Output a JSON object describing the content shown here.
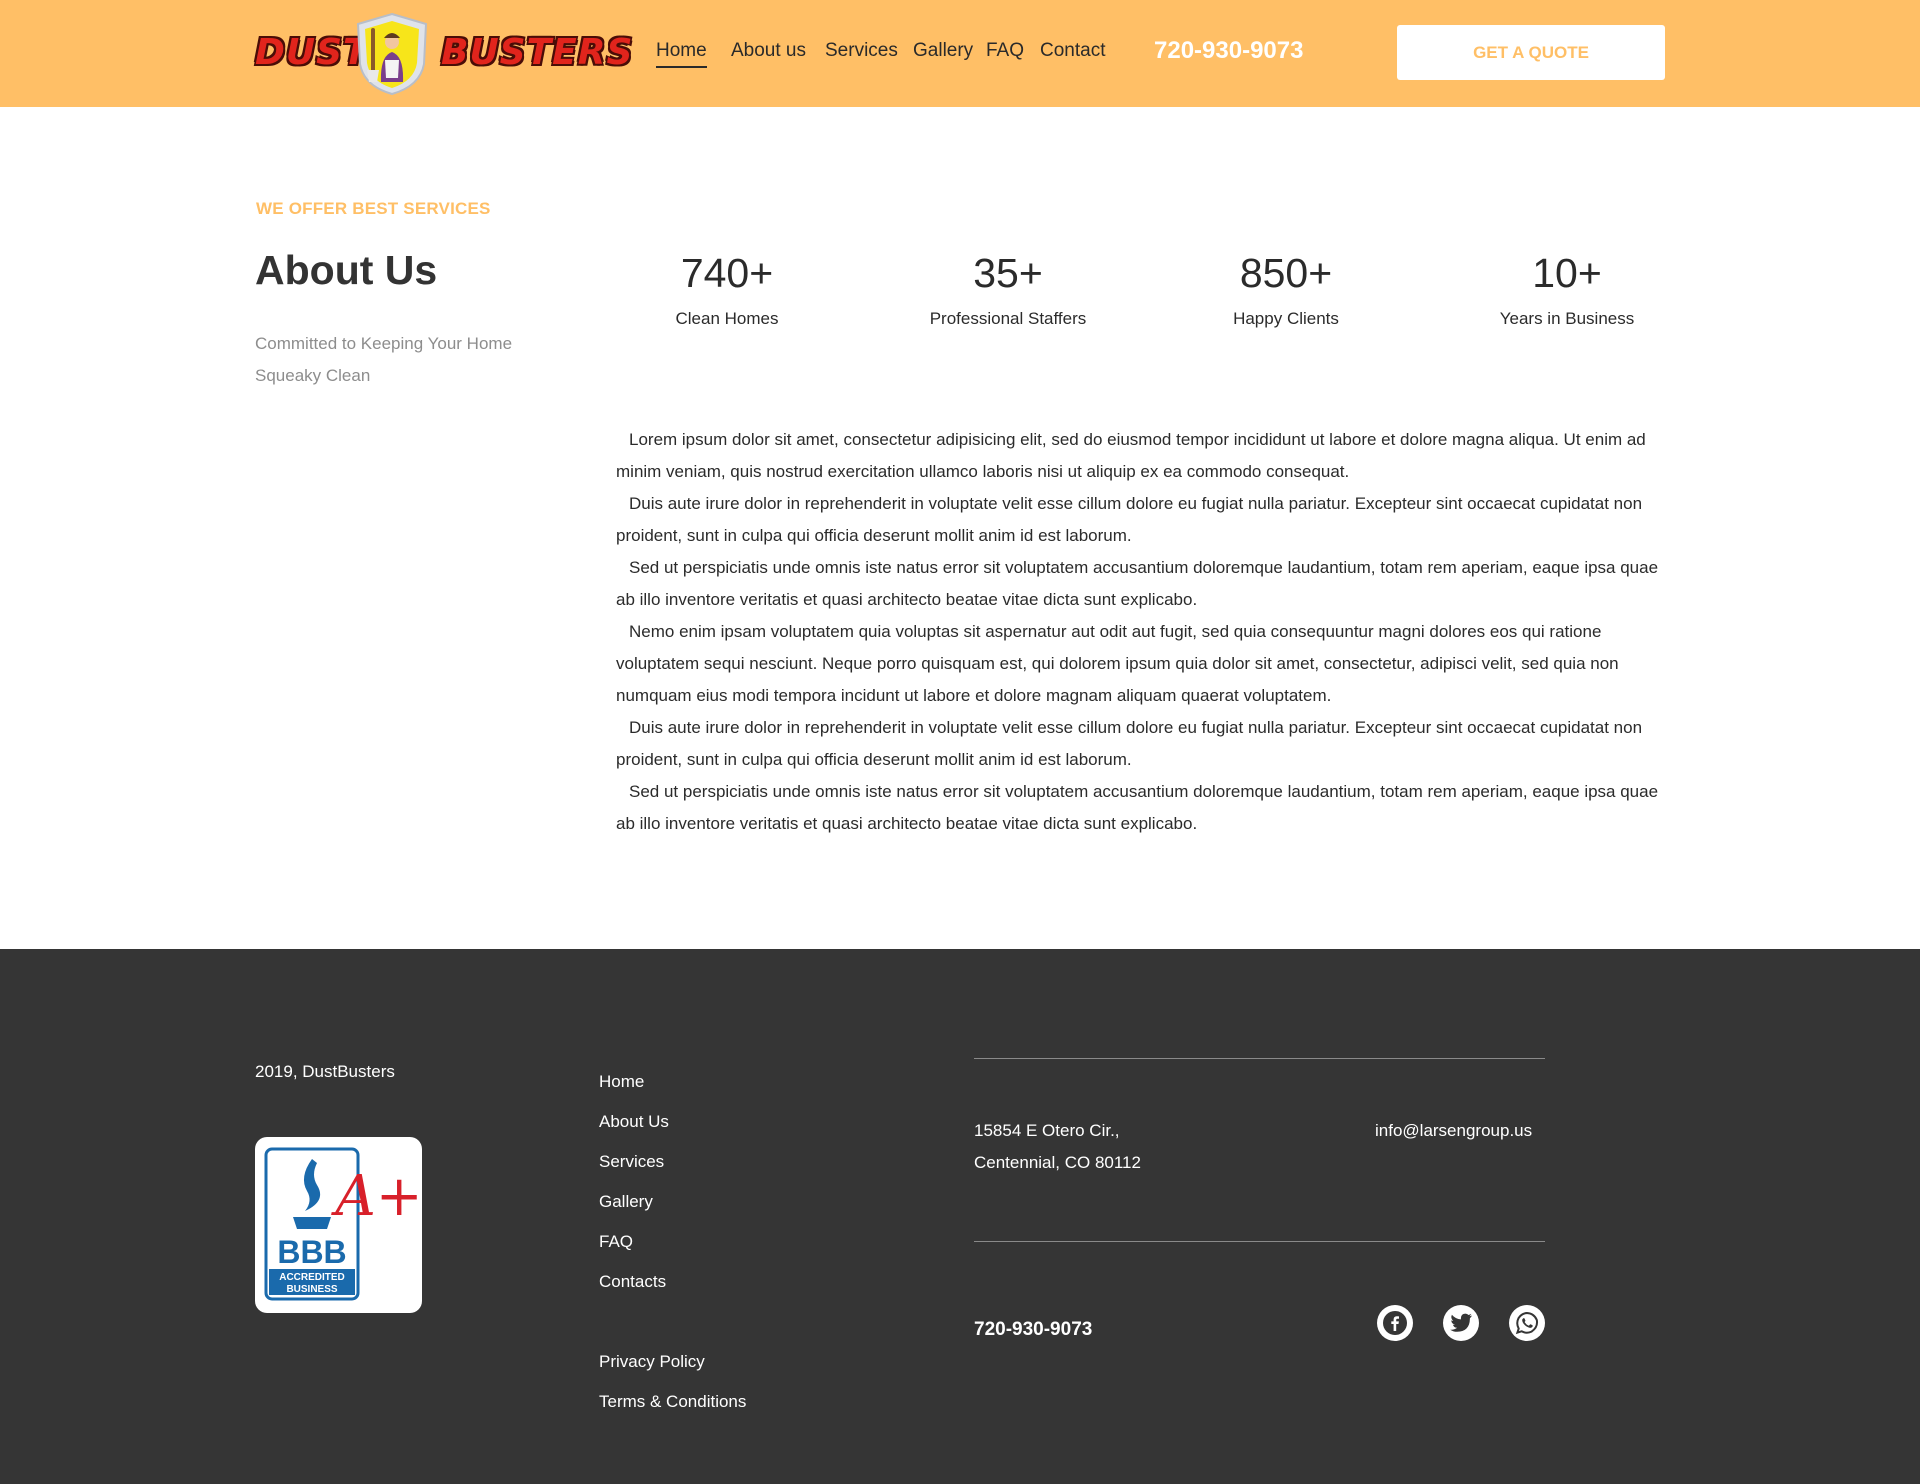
{
  "header": {
    "logo_left": "DUST",
    "logo_right": "BUSTERS",
    "nav": [
      {
        "label": "Home",
        "active": true
      },
      {
        "label": "About us"
      },
      {
        "label": "Services"
      },
      {
        "label": "Gallery"
      },
      {
        "label": "FAQ"
      },
      {
        "label": "Contact"
      }
    ],
    "phone": "720-930-9073",
    "quote_label": "GET A QUOTE"
  },
  "about": {
    "eyebrow": "WE OFFER BEST SERVICES",
    "title": "About Us",
    "subtitle": "Committed to Keeping Your Home Squeaky Clean",
    "stats": [
      {
        "value": "740+",
        "label": "Clean Homes"
      },
      {
        "value": "35+",
        "label": "Professional Staffers"
      },
      {
        "value": "850+",
        "label": "Happy Clients"
      },
      {
        "value": "10+",
        "label": "Years in Business"
      }
    ],
    "paragraphs": [
      "Lorem ipsum dolor sit amet, consectetur adipisicing elit, sed do eiusmod tempor incididunt ut labore et dolore magna aliqua. Ut enim ad minim veniam, quis nostrud exercitation ullamco laboris nisi ut aliquip ex ea commodo consequat.",
      "Duis aute irure dolor in reprehenderit in voluptate velit esse cillum dolore eu fugiat nulla pariatur. Excepteur sint occaecat cupidatat non proident, sunt in culpa qui officia deserunt mollit anim id est laborum.",
      "Sed ut perspiciatis unde omnis iste natus error sit voluptatem accusantium doloremque laudantium, totam rem aperiam, eaque ipsa quae ab illo inventore veritatis et quasi architecto beatae vitae dicta sunt explicabo.",
      "Nemo enim ipsam voluptatem quia voluptas sit aspernatur aut odit aut fugit, sed quia consequuntur magni dolores eos qui ratione voluptatem sequi nesciunt. Neque porro quisquam est, qui dolorem ipsum quia dolor sit amet, consectetur, adipisci velit, sed quia non numquam eius modi tempora incidunt ut labore et dolore magnam aliquam quaerat voluptatem.",
      "Duis aute irure dolor in reprehenderit in voluptate velit esse cillum dolore eu fugiat nulla pariatur. Excepteur sint occaecat cupidatat non proident, sunt in culpa qui officia deserunt mollit anim id est laborum.",
      "Sed ut perspiciatis unde omnis iste natus error sit voluptatem accusantium doloremque laudantium, totam rem aperiam, eaque ipsa quae ab illo inventore veritatis et quasi architecto beatae vitae dicta sunt explicabo."
    ]
  },
  "footer": {
    "copyright": "2019, DustBusters",
    "bbb": {
      "grade": "A+",
      "name": "BBB",
      "line1": "ACCREDITED",
      "line2": "BUSINESS"
    },
    "links": [
      "Home",
      "About Us",
      "Services",
      "Gallery",
      "FAQ",
      "Contacts"
    ],
    "legal": [
      "Privacy Policy",
      "Terms & Conditions"
    ],
    "address_line1": "15854 E Otero Cir.,",
    "address_line2": "Centennial, CO 80112",
    "email": "info@larsengroup.us",
    "phone": "720-930-9073",
    "social": [
      "facebook-icon",
      "twitter-icon",
      "whatsapp-icon"
    ]
  },
  "colors": {
    "accent": "#ffbf66",
    "footer_bg": "#353535",
    "logo_red": "#e1241c",
    "bbb_blue": "#1a6aac"
  }
}
